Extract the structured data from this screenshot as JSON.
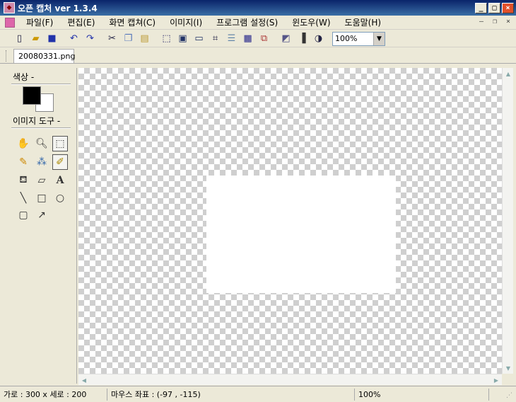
{
  "window": {
    "title": "오픈 캡처 ver 1.3.4",
    "minimize": "_",
    "maximize": "□",
    "close": "×"
  },
  "menu": [
    {
      "label": "파일(F)"
    },
    {
      "label": "편집(E)"
    },
    {
      "label": "화면 캡쳐(C)"
    },
    {
      "label": "이미지(I)"
    },
    {
      "label": "프로그램 설정(S)"
    },
    {
      "label": "윈도우(W)"
    },
    {
      "label": "도움말(H)"
    }
  ],
  "toolbar": {
    "zoom_value": "100%",
    "icons": [
      "new-icon",
      "open-icon",
      "save-icon",
      "undo-icon",
      "redo-icon",
      "cut-icon",
      "copy-icon",
      "paste-icon",
      "capture-region-icon",
      "capture-window-icon",
      "capture-fullscreen-icon",
      "capture-crosshair-icon",
      "capture-scroll-icon",
      "capture-menu-icon",
      "capture-multi-icon",
      "invert-icon",
      "gradient-icon",
      "contrast-icon"
    ]
  },
  "tabs": [
    {
      "label": "20080331.png"
    }
  ],
  "left_panel": {
    "color_label": "색상 -",
    "tools_label": "이미지 도구 -",
    "foreground_color": "#000000",
    "background_color": "#ffffff"
  },
  "status": {
    "size": "가로 : 300 x 세로 : 200",
    "mouse": "마우스 좌표 : (-97 ,  -115)",
    "zoom": "100%"
  }
}
